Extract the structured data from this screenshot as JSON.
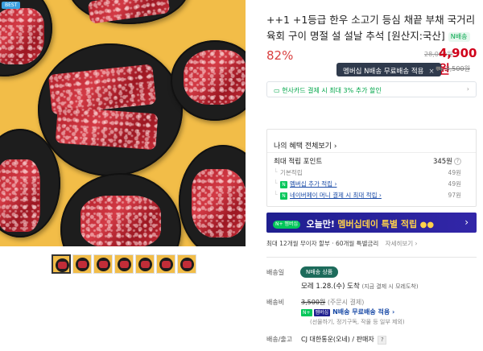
{
  "product": {
    "sale_tag": "BEST",
    "title": "++1 +1등급 한우 소고기 등심 채끝 부채 국거리 육회 구이 명절 설 설날 추석 [원산지:국산]",
    "title_badge": "N배송",
    "discount_rate": "82%",
    "original_price": "28,000원",
    "sale_price": "4,900원",
    "tooltip": "멤버십 N배송 무료배송 적용",
    "tooltip_close": "×",
    "shipping_fee_small": "3,500원",
    "card_banner": "현사카드 결제 시 최대 3% 추가 할인",
    "card_banner_chevron": "›"
  },
  "benefits": {
    "header": "나의 혜택 전체보기 ›",
    "points_title": "최대 적립 포인트",
    "points_total": "345원",
    "rows": [
      {
        "label": "기본적립",
        "value": "49원",
        "badge": ""
      },
      {
        "label": "멤버십 추가 적립 ›",
        "value": "49원",
        "badge": "N"
      },
      {
        "label": "네이버페이 머니 결제 시 최대 적립 ›",
        "value": "97원",
        "badge": "N"
      }
    ]
  },
  "membership_banner": {
    "badge": "N+ 멤버십",
    "text_main": "오늘만!",
    "text_accent": "멤버십데이 특별 적립",
    "chevron": "›"
  },
  "installment": {
    "text": "최대 12개월 무이자 할부 · 60개월 특별금리",
    "link": "자세히보기 ›"
  },
  "delivery": {
    "label": "배송일",
    "badge": "N배송 상품",
    "date": "모레 1.28.(수) 도착",
    "date_note": "(지금 결제 시 모레도착)"
  },
  "shipping_fee": {
    "label": "배송비",
    "original": "3,500원",
    "original_note": "(주문시 결제)",
    "free_badge_1": "N+",
    "free_badge_2": "멤버십",
    "free_text": "N배송 무료배송 적용 ›",
    "note": "(선물하기, 정기구독, 작물 등 일부 제외)"
  },
  "seller": {
    "label": "배송/출고",
    "info": "CJ 대한통운(오네) / 판매자",
    "q": "?"
  },
  "thumbnails": [
    "thumb-1",
    "thumb-2",
    "thumb-3",
    "thumb-4",
    "thumb-5",
    "thumb-6",
    "thumb-7"
  ]
}
